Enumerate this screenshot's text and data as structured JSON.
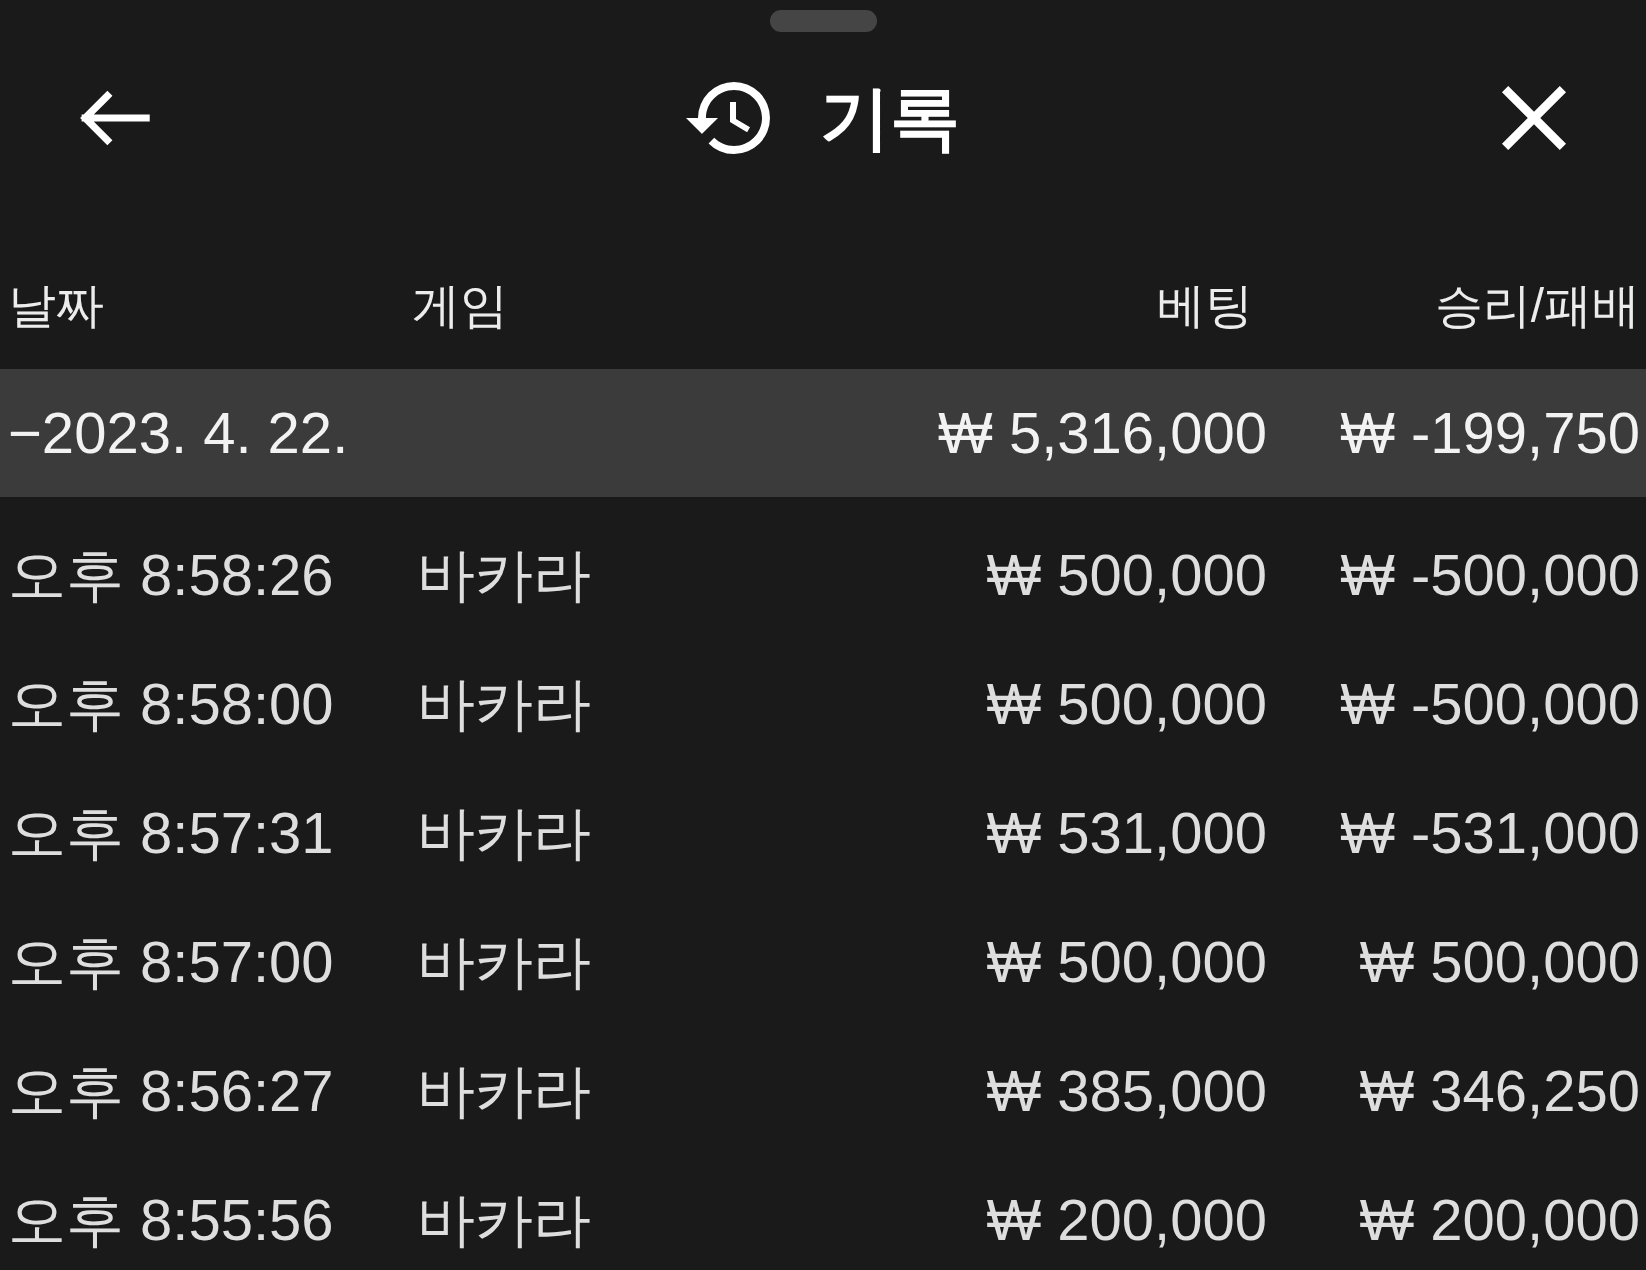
{
  "header": {
    "title": "기록"
  },
  "table": {
    "columns": [
      "날짜",
      "게임",
      "베팅",
      "승리/패배"
    ],
    "rows": [
      {
        "kind": "summary",
        "date": "−2023. 4. 22.",
        "bet": "₩ 5,316,000",
        "result": "₩ -199,750"
      },
      {
        "kind": "entry",
        "time": "오후 8:58:26",
        "game": "바카라",
        "bet": "₩ 500,000",
        "result": "₩ -500,000"
      },
      {
        "kind": "entry",
        "time": "오후 8:58:00",
        "game": "바카라",
        "bet": "₩ 500,000",
        "result": "₩ -500,000"
      },
      {
        "kind": "entry",
        "time": "오후 8:57:31",
        "game": "바카라",
        "bet": "₩ 531,000",
        "result": "₩ -531,000"
      },
      {
        "kind": "entry",
        "time": "오후 8:57:00",
        "game": "바카라",
        "bet": "₩ 500,000",
        "result": "₩ 500,000"
      },
      {
        "kind": "entry",
        "time": "오후 8:56:27",
        "game": "바카라",
        "bet": "₩ 385,000",
        "result": "₩ 346,250"
      },
      {
        "kind": "entry",
        "time": "오후 8:55:56",
        "game": "바카라",
        "bet": "₩ 200,000",
        "result": "₩ 200,000"
      }
    ]
  }
}
